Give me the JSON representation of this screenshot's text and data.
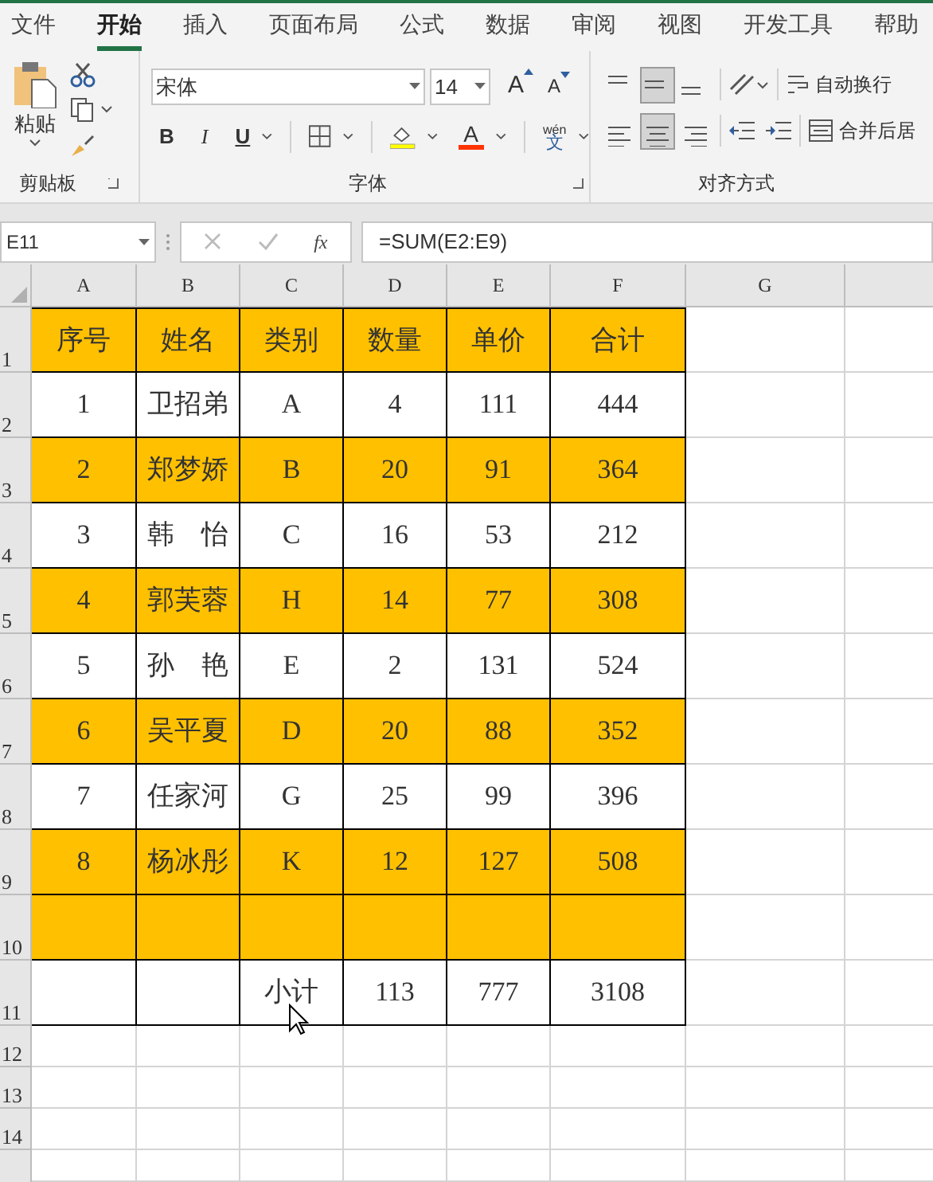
{
  "tabs": [
    {
      "label": "文件",
      "selected": false
    },
    {
      "label": "开始",
      "selected": true
    },
    {
      "label": "插入",
      "selected": false
    },
    {
      "label": "页面布局",
      "selected": false
    },
    {
      "label": "公式",
      "selected": false
    },
    {
      "label": "数据",
      "selected": false
    },
    {
      "label": "审阅",
      "selected": false
    },
    {
      "label": "视图",
      "selected": false
    },
    {
      "label": "开发工具",
      "selected": false
    },
    {
      "label": "帮助",
      "selected": false
    }
  ],
  "clipboard": {
    "paste_label": "粘贴",
    "group_label": "剪贴板"
  },
  "font": {
    "font_name": "宋体",
    "font_size": "14",
    "grow_font": "A",
    "shrink_font": "A",
    "bold": "B",
    "italic": "I",
    "underline": "U",
    "font_color": "A",
    "phonetic_top": "wén",
    "phonetic_char": "文",
    "group_label": "字体"
  },
  "alignment": {
    "vertical_align": [
      {
        "selected": false
      },
      {
        "selected": true
      },
      {
        "selected": false
      }
    ],
    "horizontal_align": [
      {
        "selected": false
      },
      {
        "selected": true
      },
      {
        "selected": false
      }
    ],
    "wrap_text": "自动换行",
    "merge_center": "合并后居",
    "group_label": "对齐方式"
  },
  "name_box": "E11",
  "function_label": "fx",
  "formula": "=SUM(E2:E9)",
  "columns": [
    "A",
    "B",
    "C",
    "D",
    "E",
    "F",
    "G"
  ],
  "rows": [
    {
      "number": "1",
      "highlighted": true,
      "cells": [
        "序号",
        "姓名",
        "类别",
        "数量",
        "单价",
        "合计"
      ]
    },
    {
      "number": "2",
      "highlighted": false,
      "cells": [
        "1",
        "卫招弟",
        "A",
        "4",
        "111",
        "444"
      ]
    },
    {
      "number": "3",
      "highlighted": true,
      "cells": [
        "2",
        "郑梦娇",
        "B",
        "20",
        "91",
        "364"
      ]
    },
    {
      "number": "4",
      "highlighted": false,
      "cells": [
        "3",
        "韩　怡",
        "C",
        "16",
        "53",
        "212"
      ]
    },
    {
      "number": "5",
      "highlighted": true,
      "cells": [
        "4",
        "郭芙蓉",
        "H",
        "14",
        "77",
        "308"
      ]
    },
    {
      "number": "6",
      "highlighted": false,
      "cells": [
        "5",
        "孙　艳",
        "E",
        "2",
        "131",
        "524"
      ]
    },
    {
      "number": "7",
      "highlighted": true,
      "cells": [
        "6",
        "吴平夏",
        "D",
        "20",
        "88",
        "352"
      ]
    },
    {
      "number": "8",
      "highlighted": false,
      "cells": [
        "7",
        "任家河",
        "G",
        "25",
        "99",
        "396"
      ]
    },
    {
      "number": "9",
      "highlighted": true,
      "cells": [
        "8",
        "杨冰彤",
        "K",
        "12",
        "127",
        "508"
      ]
    },
    {
      "number": "10",
      "highlighted": true,
      "cells": [
        "",
        "",
        "",
        "",
        "",
        ""
      ]
    },
    {
      "number": "11",
      "highlighted": false,
      "cells": [
        "",
        "",
        "小计",
        "113",
        "777",
        "3108"
      ]
    }
  ],
  "empty_rows": [
    "12",
    "13",
    "14"
  ]
}
